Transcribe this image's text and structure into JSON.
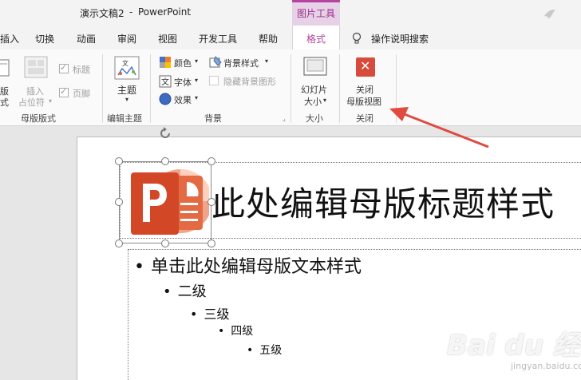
{
  "titlebar": {
    "doc_name": "演示文稿2",
    "separator": "-",
    "app_name": "PowerPoint",
    "context_header": "图片工具"
  },
  "tabs": [
    {
      "label": "插入"
    },
    {
      "label": "切换"
    },
    {
      "label": "动画"
    },
    {
      "label": "审阅"
    },
    {
      "label": "视图"
    },
    {
      "label": "开发工具"
    },
    {
      "label": "帮助"
    }
  ],
  "context_tab": {
    "label": "格式"
  },
  "tell_me": "操作说明搜索",
  "ribbon": {
    "master_layout": {
      "cut_label_1": "版",
      "cut_label_2": "式",
      "insert_placeholder_1": "插入",
      "insert_placeholder_2": "占位符",
      "title_check": "标题",
      "footer_check": "页脚",
      "group_label": "母版版式"
    },
    "edit_theme": {
      "theme_label": "主题",
      "group_label": "编辑主题"
    },
    "background": {
      "colors": "颜色",
      "fonts": "字体",
      "effects": "效果",
      "bg_styles": "背景样式",
      "hide_bg": "隐藏背景图形",
      "group_label": "背景"
    },
    "size": {
      "slide_size_1": "幻灯片",
      "slide_size_2": "大小",
      "group_label": "大小"
    },
    "close": {
      "close_1": "关闭",
      "close_2": "母版视图",
      "group_label": "关闭"
    }
  },
  "slide": {
    "title": "此处编辑母版标题样式",
    "levels": [
      {
        "bullet": "•",
        "text": "单击此处编辑母版文本样式"
      },
      {
        "bullet": "•",
        "text": "二级"
      },
      {
        "bullet": "•",
        "text": "三级"
      },
      {
        "bullet": "•",
        "text": "四级"
      },
      {
        "bullet": "•",
        "text": "五级"
      }
    ]
  },
  "watermark": {
    "brand": "Bai du 经验",
    "sub": "jingyan.baidu.com"
  },
  "colors": {
    "context_accent": "#b4449f",
    "close_red": "#d64b3b",
    "ppt_orange": "#d24726",
    "arrow_red": "#e04a3f"
  }
}
